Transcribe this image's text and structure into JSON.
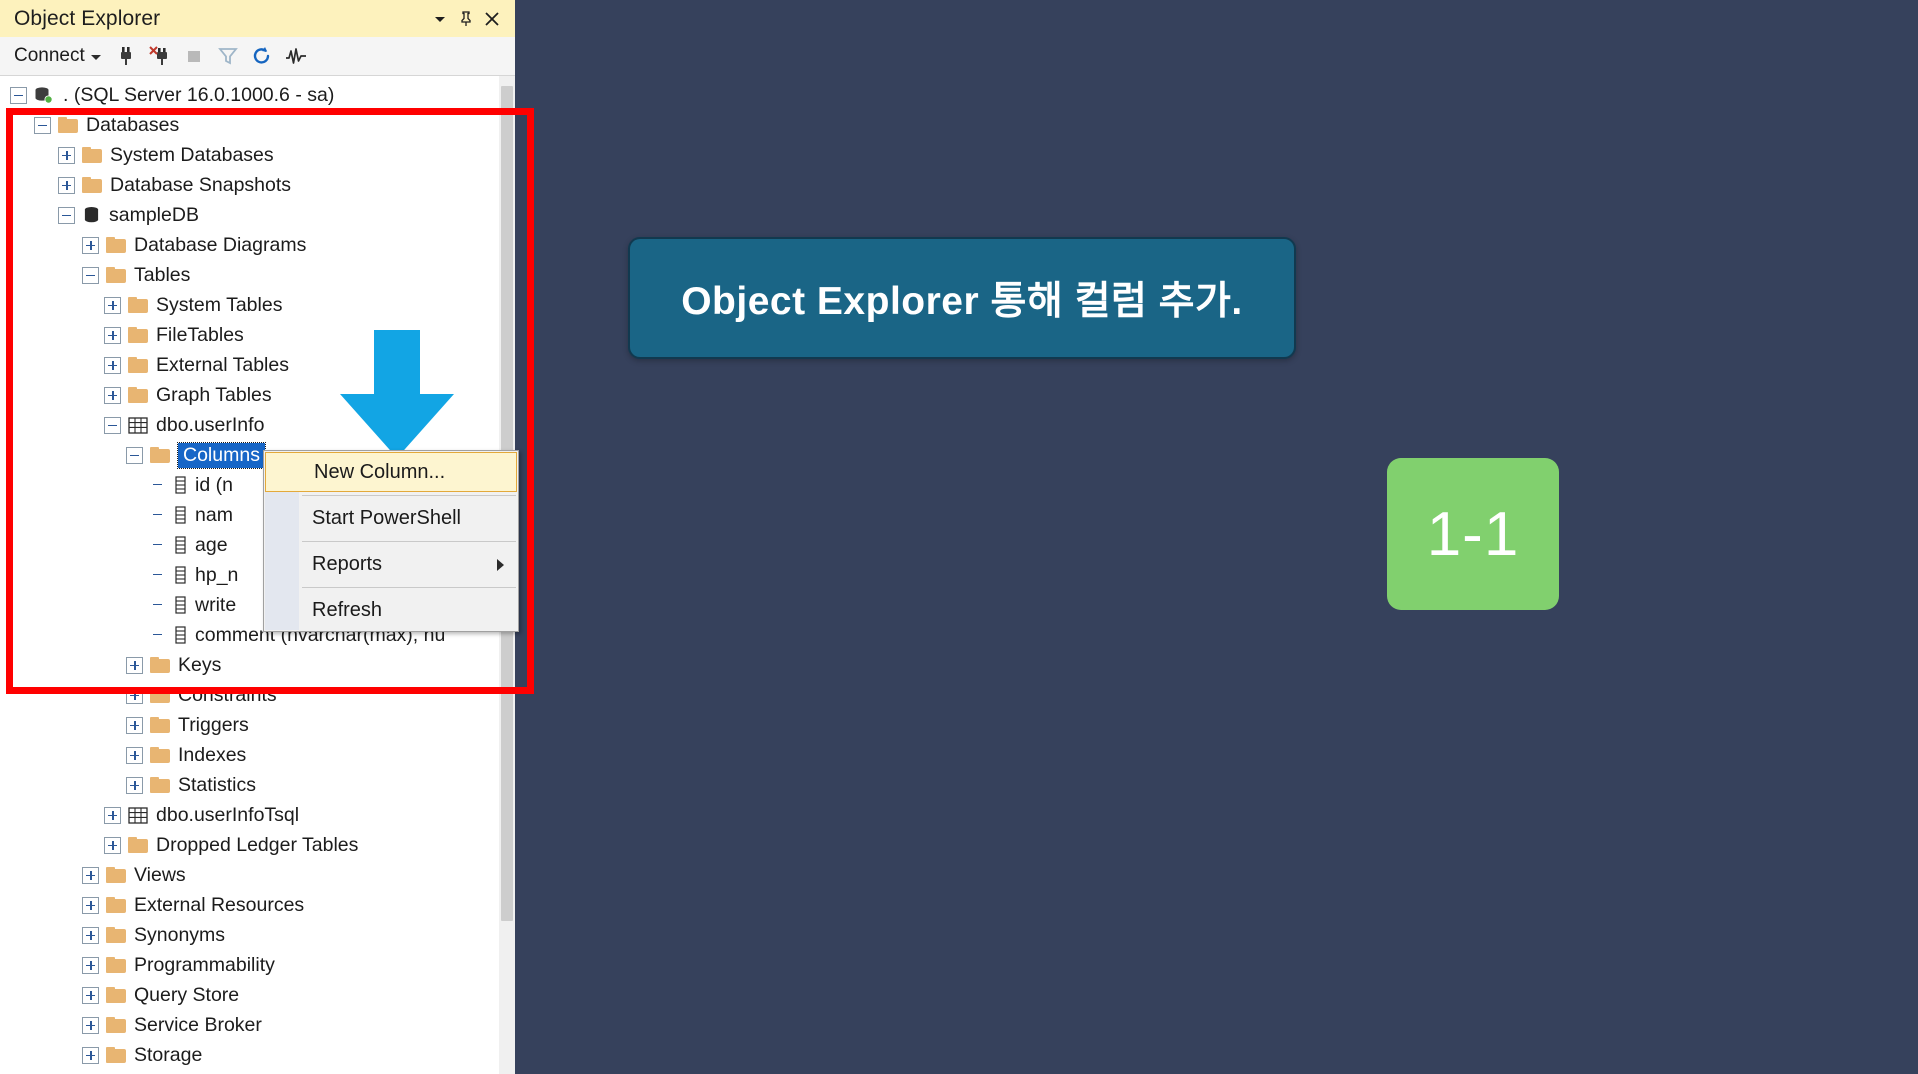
{
  "panel": {
    "title": "Object Explorer",
    "titlebar_buttons": [
      {
        "name": "dropdown-icon",
        "glyph": "▾"
      },
      {
        "name": "pin-icon",
        "glyph": "⍜"
      },
      {
        "name": "close-icon",
        "glyph": "✕"
      }
    ],
    "toolbar": {
      "connect_label": "Connect",
      "icons": [
        "connect-object-explorer-icon",
        "disconnect-object-explorer-icon",
        "stop-icon",
        "filter-icon",
        "refresh-icon",
        "activity-monitor-icon"
      ]
    }
  },
  "tree": [
    {
      "label": ". (SQL Server 16.0.1000.6 - sa)",
      "indent": 0,
      "state": "minus",
      "icon": "server-icon"
    },
    {
      "label": "Databases",
      "indent": 1,
      "state": "minus",
      "icon": "folder-icon"
    },
    {
      "label": "System Databases",
      "indent": 2,
      "state": "plus",
      "icon": "folder-icon"
    },
    {
      "label": "Database Snapshots",
      "indent": 2,
      "state": "plus",
      "icon": "folder-icon"
    },
    {
      "label": "sampleDB",
      "indent": 2,
      "state": "minus",
      "icon": "database-icon"
    },
    {
      "label": "Database Diagrams",
      "indent": 3,
      "state": "plus",
      "icon": "folder-icon"
    },
    {
      "label": "Tables",
      "indent": 3,
      "state": "minus",
      "icon": "folder-icon"
    },
    {
      "label": "System Tables",
      "indent": 4,
      "state": "plus",
      "icon": "folder-icon"
    },
    {
      "label": "FileTables",
      "indent": 4,
      "state": "plus",
      "icon": "folder-icon"
    },
    {
      "label": "External Tables",
      "indent": 4,
      "state": "plus",
      "icon": "folder-icon"
    },
    {
      "label": "Graph Tables",
      "indent": 4,
      "state": "plus",
      "icon": "folder-icon"
    },
    {
      "label": "dbo.userInfo",
      "indent": 4,
      "state": "minus",
      "icon": "table-icon"
    },
    {
      "label": "Columns",
      "indent": 5,
      "state": "minus",
      "icon": "folder-icon",
      "selected": true
    },
    {
      "label": "id (n",
      "indent": 6,
      "state": "none",
      "icon": "column-icon"
    },
    {
      "label": "nam",
      "indent": 6,
      "state": "none",
      "icon": "column-icon"
    },
    {
      "label": "age",
      "indent": 6,
      "state": "none",
      "icon": "column-icon"
    },
    {
      "label": "hp_n",
      "indent": 6,
      "state": "none",
      "icon": "column-icon"
    },
    {
      "label": "write",
      "indent": 6,
      "state": "none",
      "icon": "column-icon"
    },
    {
      "label": "comment (nvarchar(max), nu",
      "indent": 6,
      "state": "none",
      "icon": "column-icon"
    },
    {
      "label": "Keys",
      "indent": 5,
      "state": "plus",
      "icon": "folder-icon"
    },
    {
      "label": "Constraints",
      "indent": 5,
      "state": "plus",
      "icon": "folder-icon"
    },
    {
      "label": "Triggers",
      "indent": 5,
      "state": "plus",
      "icon": "folder-icon"
    },
    {
      "label": "Indexes",
      "indent": 5,
      "state": "plus",
      "icon": "folder-icon"
    },
    {
      "label": "Statistics",
      "indent": 5,
      "state": "plus",
      "icon": "folder-icon"
    },
    {
      "label": "dbo.userInfoTsql",
      "indent": 4,
      "state": "plus",
      "icon": "table-icon"
    },
    {
      "label": "Dropped Ledger Tables",
      "indent": 4,
      "state": "plus",
      "icon": "folder-icon"
    },
    {
      "label": "Views",
      "indent": 3,
      "state": "plus",
      "icon": "folder-icon"
    },
    {
      "label": "External Resources",
      "indent": 3,
      "state": "plus",
      "icon": "folder-icon"
    },
    {
      "label": "Synonyms",
      "indent": 3,
      "state": "plus",
      "icon": "folder-icon"
    },
    {
      "label": "Programmability",
      "indent": 3,
      "state": "plus",
      "icon": "folder-icon"
    },
    {
      "label": "Query Store",
      "indent": 3,
      "state": "plus",
      "icon": "folder-icon"
    },
    {
      "label": "Service Broker",
      "indent": 3,
      "state": "plus",
      "icon": "folder-icon"
    },
    {
      "label": "Storage",
      "indent": 3,
      "state": "plus",
      "icon": "folder-icon"
    }
  ],
  "context_menu": {
    "items": [
      {
        "label": "New Column...",
        "highlighted": true,
        "submenu": false
      },
      {
        "label": "Start PowerShell",
        "highlighted": false,
        "submenu": false
      },
      {
        "label": "Reports",
        "highlighted": false,
        "submenu": true
      },
      {
        "label": "Refresh",
        "highlighted": false,
        "submenu": false
      }
    ]
  },
  "annotations": {
    "banner_text": "Object Explorer 통해 컬럼 추가.",
    "step_badge": "1-1",
    "arrow": "down-arrow-icon",
    "highlight_rect": "red-highlight-rectangle"
  },
  "colors": {
    "titlebar": "#fdf2bd",
    "selection": "#1766c7",
    "menu_highlight_bg": "#fdf5d0",
    "menu_highlight_border": "#e3a93b",
    "annotation_red": "#ff0000",
    "arrow_blue": "#12a5e4",
    "banner_bg": "#1a6586",
    "badge_green": "#81d06e",
    "background": "#36415c"
  }
}
